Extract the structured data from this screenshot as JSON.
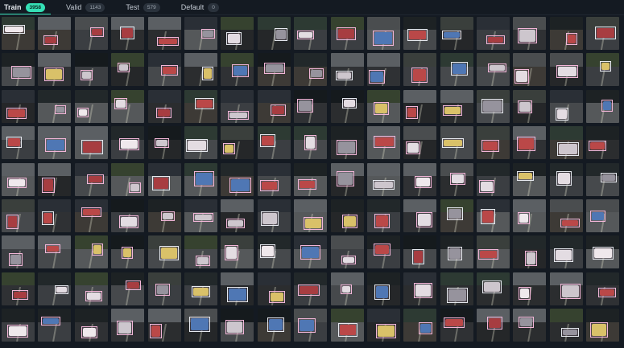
{
  "tabs": [
    {
      "label": "Train",
      "count": "3958",
      "active": true
    },
    {
      "label": "Valid",
      "count": "1143",
      "active": false
    },
    {
      "label": "Test",
      "count": "579",
      "active": false
    },
    {
      "label": "Default",
      "count": "0",
      "active": false
    }
  ],
  "colors": {
    "accent": "#35e0b6",
    "background": "#141a22",
    "box_pink": "#f2b6d8",
    "box_white": "#e6e9ef"
  },
  "grid": {
    "rows": 9,
    "columns": 17,
    "thumbnail_content": "crashed-vehicle-image"
  }
}
